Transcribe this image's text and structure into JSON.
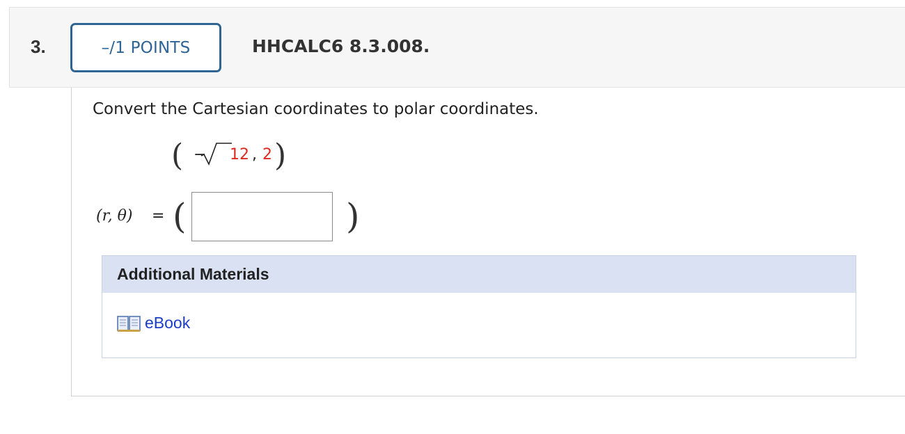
{
  "question": {
    "number": "3.",
    "points_label": "–/1 POINTS",
    "title": "HHCALC6 8.3.008."
  },
  "problem": {
    "prompt": "Convert the Cartesian coordinates to polar coordinates.",
    "point": {
      "minus": "−",
      "radicand": "12",
      "comma": ",",
      "y": "2"
    }
  },
  "answer": {
    "label_vars": "(r, θ)",
    "equals": "=",
    "value": "",
    "placeholder": ""
  },
  "materials": {
    "title": "Additional Materials",
    "ebook_label": "eBook",
    "ebook_icon": "open-book-icon"
  },
  "colors": {
    "badge": "#2e6594",
    "highlight": "#e02a1f",
    "link": "#1a3ec7",
    "materials_header": "#d9e1f3"
  }
}
